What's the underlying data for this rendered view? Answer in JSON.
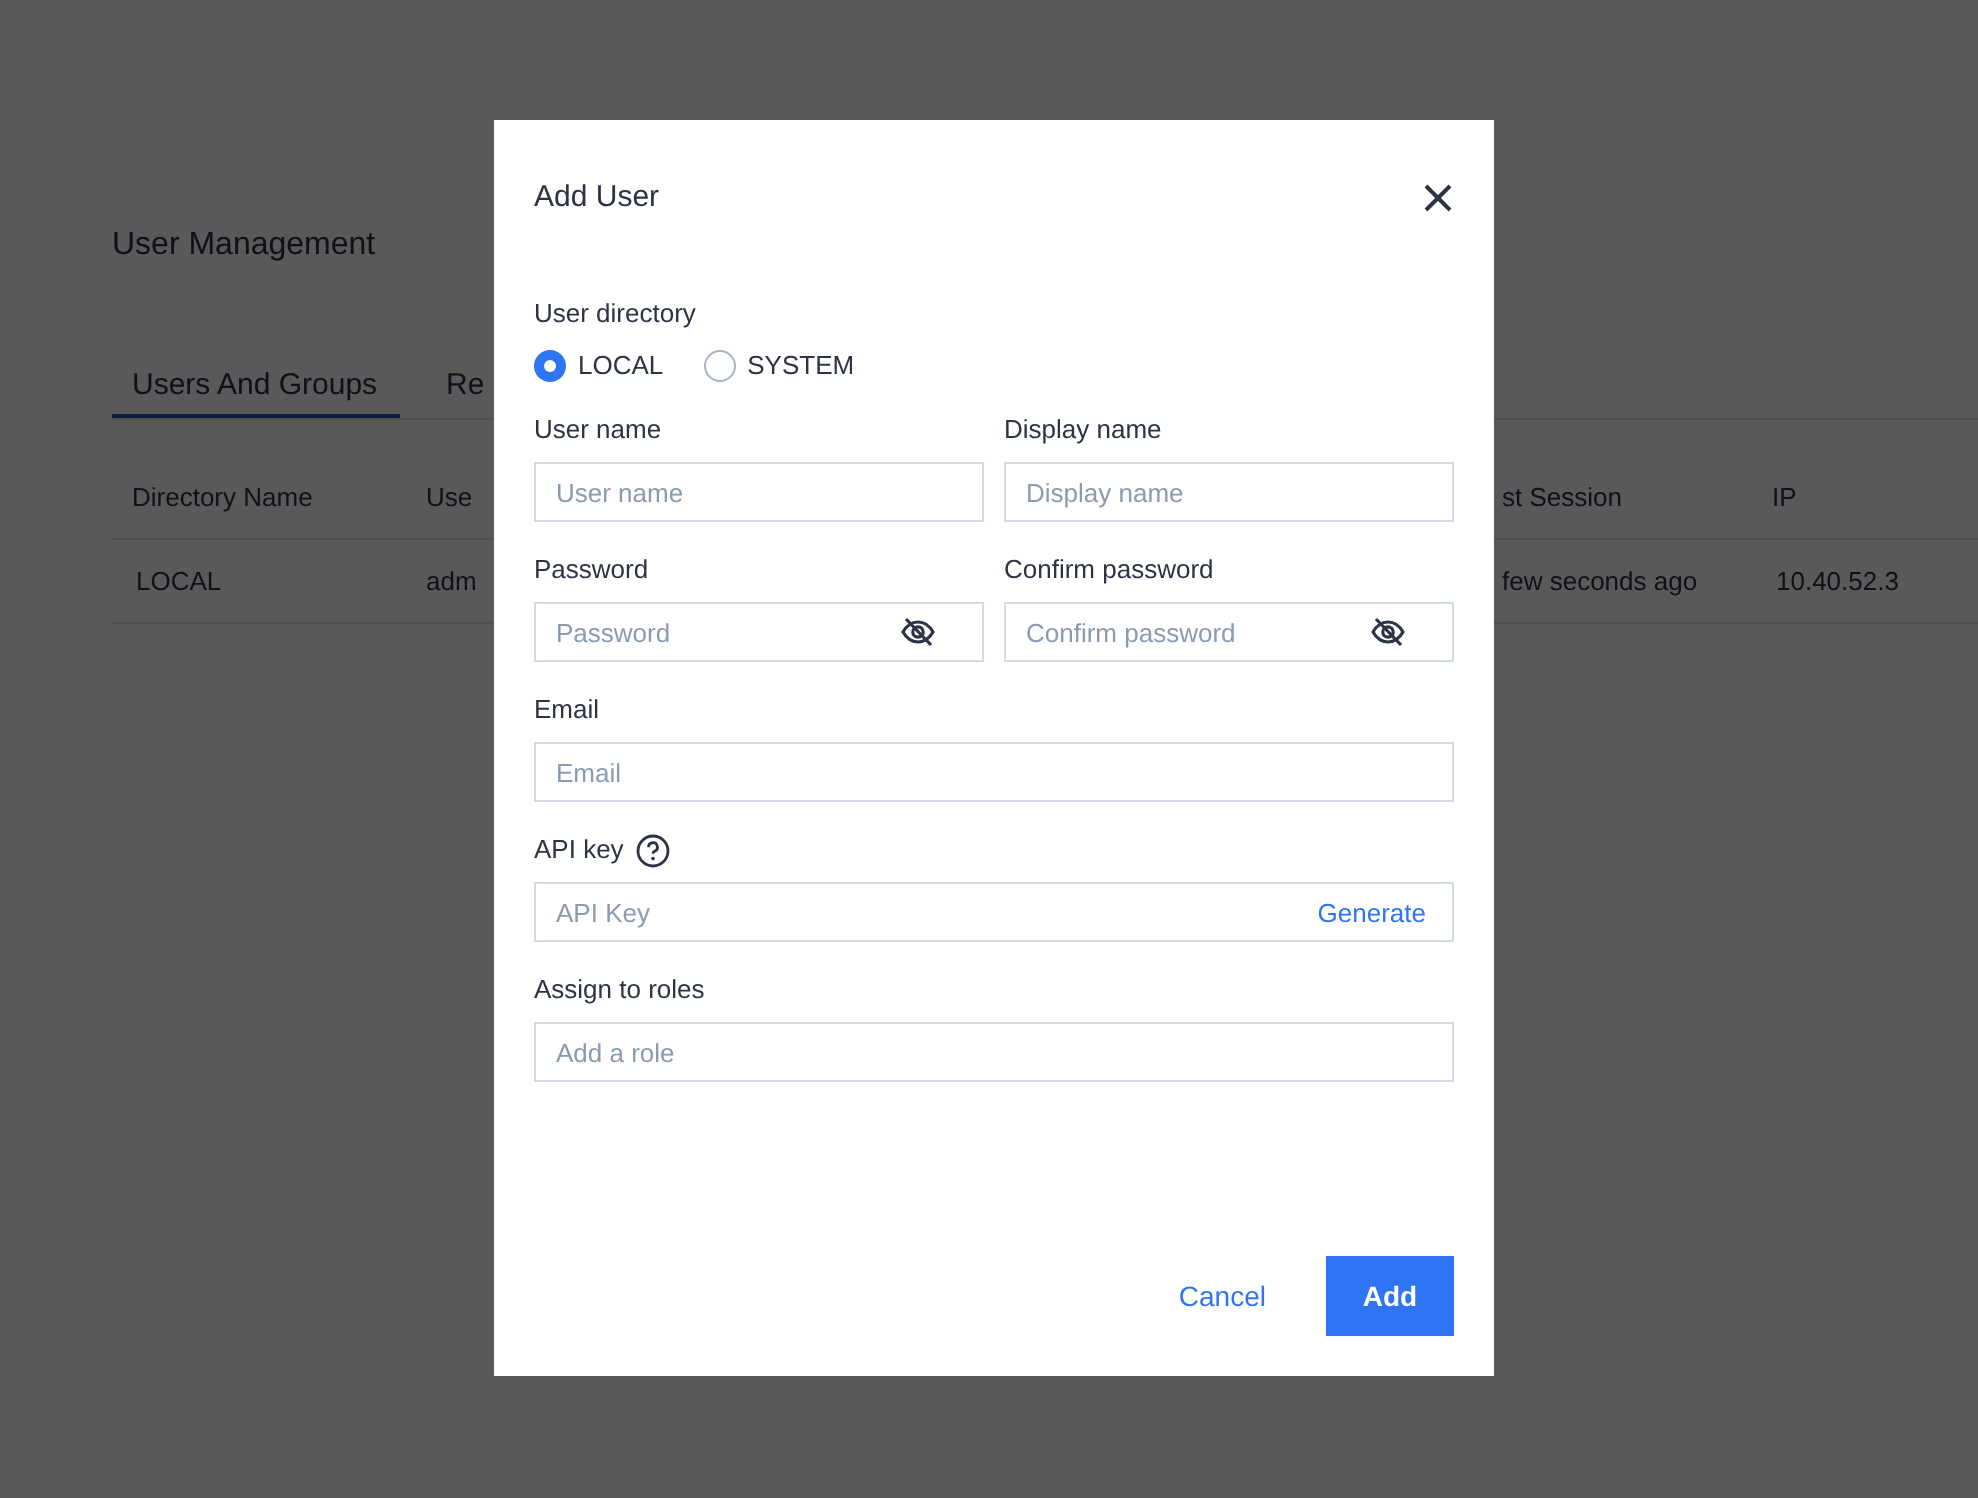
{
  "page": {
    "title": "User Management",
    "tabs": [
      {
        "label": "Users And Groups",
        "selected": true
      },
      {
        "label": "Re",
        "selected": false
      }
    ],
    "table": {
      "columns": [
        "Directory Name",
        "Use",
        "st Session",
        "IP"
      ],
      "rows": [
        [
          "LOCAL",
          "adm",
          "few seconds ago",
          "10.40.52.3"
        ]
      ]
    }
  },
  "dialog": {
    "title": "Add User",
    "directory": {
      "label": "User directory",
      "options": [
        {
          "label": "LOCAL",
          "selected": true
        },
        {
          "label": "SYSTEM",
          "selected": false
        }
      ]
    },
    "rows": [
      [
        {
          "label": "User name",
          "placeholder": "User name",
          "kind": "text"
        },
        {
          "label": "Display name",
          "placeholder": "Display name",
          "kind": "text"
        }
      ],
      [
        {
          "label": "Password",
          "placeholder": "Password",
          "kind": "password"
        },
        {
          "label": "Confirm password",
          "placeholder": "Confirm password",
          "kind": "password"
        }
      ],
      [
        {
          "label": "Email",
          "placeholder": "Email",
          "kind": "text"
        }
      ],
      [
        {
          "label": "API key",
          "placeholder": "API Key",
          "kind": "action",
          "help": true,
          "action": "Generate"
        }
      ],
      [
        {
          "label": "Assign to roles",
          "placeholder": "Add a role",
          "kind": "text"
        }
      ]
    ],
    "buttons": [
      {
        "label": "Cancel",
        "kind": "link"
      },
      {
        "label": "Add",
        "kind": "primary"
      }
    ]
  }
}
